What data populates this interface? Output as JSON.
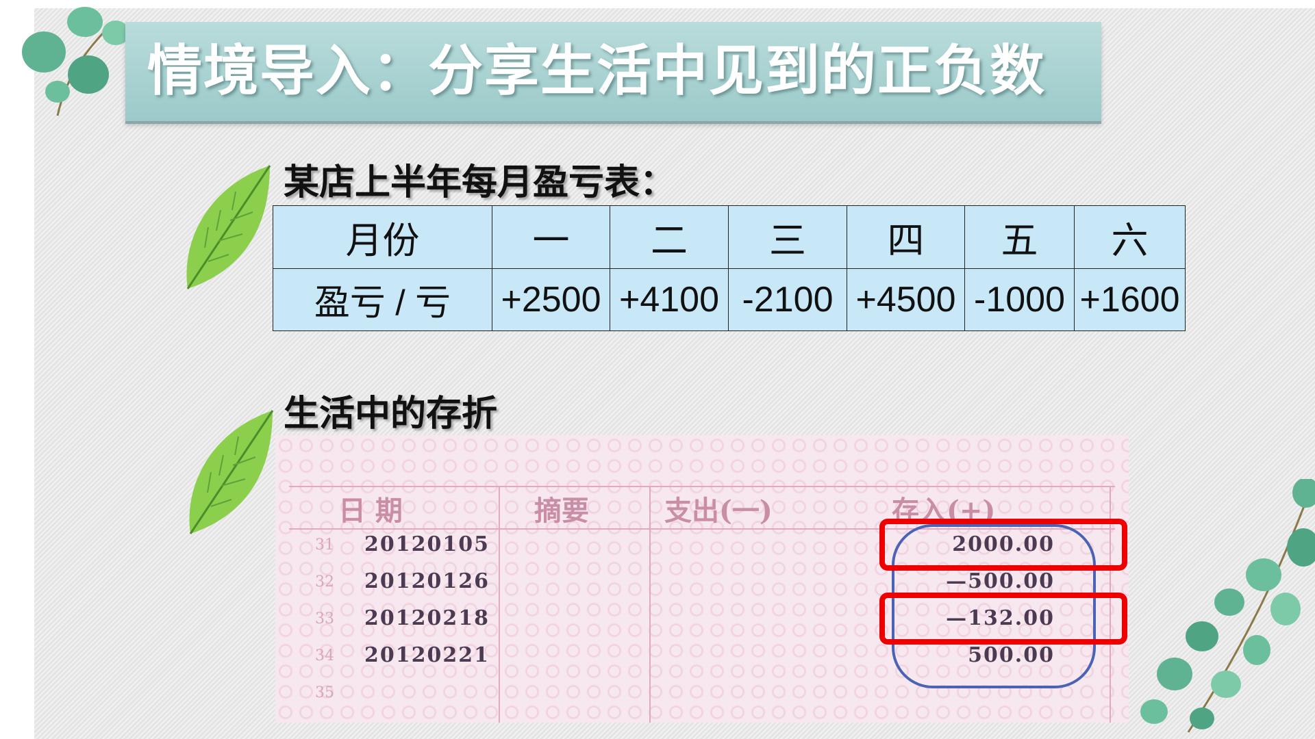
{
  "title": "情境导入：分享生活中见到的正负数",
  "table_section": {
    "heading": "某店上半年每月盈亏表：",
    "headers": [
      "月份",
      "一",
      "二",
      "三",
      "四",
      "五",
      "六"
    ],
    "row_label": "盈亏 / 亏",
    "values": [
      "+2500",
      "+4100",
      "-2100",
      "+4500",
      "-1000",
      "+1600"
    ]
  },
  "passbook_section": {
    "heading": "生活中的存折",
    "columns": [
      "日  期",
      "摘要",
      "支出(一)",
      "存入(+)"
    ],
    "rows": [
      {
        "num": "31",
        "date": "20120105",
        "amount": "2000.00"
      },
      {
        "num": "32",
        "date": "20120126",
        "amount": "—500.00"
      },
      {
        "num": "33",
        "date": "20120218",
        "amount": "—132.00"
      },
      {
        "num": "34",
        "date": "20120221",
        "amount": "500.00"
      },
      {
        "num": "35",
        "date": "",
        "amount": ""
      }
    ]
  },
  "colors": {
    "title_banner": "#a8d3d3",
    "table_fill": "#c9e8f7",
    "highlight_box": "#ee0000",
    "oval": "#4b63b5",
    "leaf_green": "#7cc043"
  }
}
